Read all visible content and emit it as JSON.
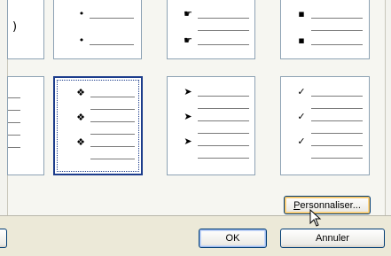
{
  "top_left_tile_text": ")",
  "bullets": {
    "row1": [
      "•",
      "☛",
      "▪"
    ],
    "row2": [
      "❖",
      "➤",
      "✓"
    ]
  },
  "buttons": {
    "customize_mnemonic": "P",
    "customize_rest": "ersonnaliser...",
    "ok": "OK",
    "cancel": "Annuler"
  },
  "colors": {
    "selected_border": "#1d3d8c",
    "tile_border": "#8da2b4",
    "dialog_bg": "#ece9d8"
  }
}
